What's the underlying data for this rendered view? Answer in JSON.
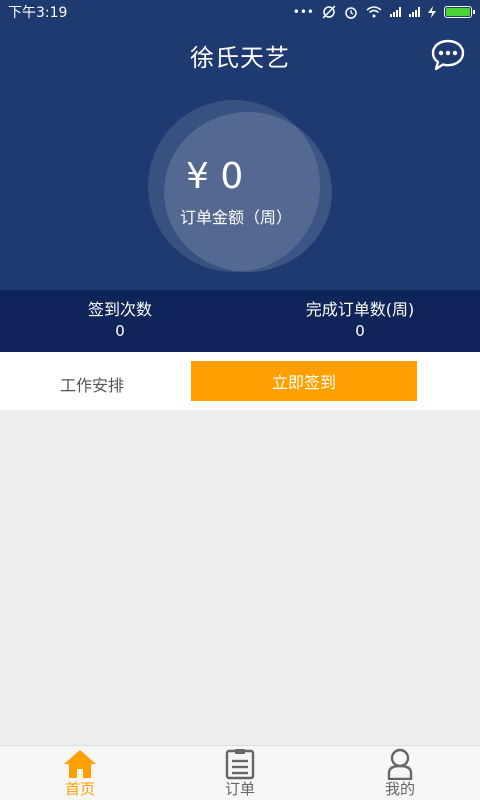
{
  "status_bar": {
    "time": "下午3:19",
    "dots": "•••"
  },
  "header": {
    "title": "徐氏天艺"
  },
  "summary": {
    "amount": "¥ 0",
    "amount_label": "订单金额（周）"
  },
  "stats": [
    {
      "label": "签到次数",
      "value": "0"
    },
    {
      "label": "完成订单数(周)",
      "value": "0"
    }
  ],
  "actions": {
    "work_schedule_label": "工作安排",
    "checkin_label": "立即签到"
  },
  "tabs": [
    {
      "label": "首页",
      "icon": "home-icon",
      "active": true
    },
    {
      "label": "订单",
      "icon": "clipboard-icon",
      "active": false
    },
    {
      "label": "我的",
      "icon": "user-icon",
      "active": false
    }
  ],
  "colors": {
    "header_bg": "#1e3a70",
    "stats_bg": "#0f2458",
    "accent": "#ffa000",
    "battery": "#4cd137"
  }
}
